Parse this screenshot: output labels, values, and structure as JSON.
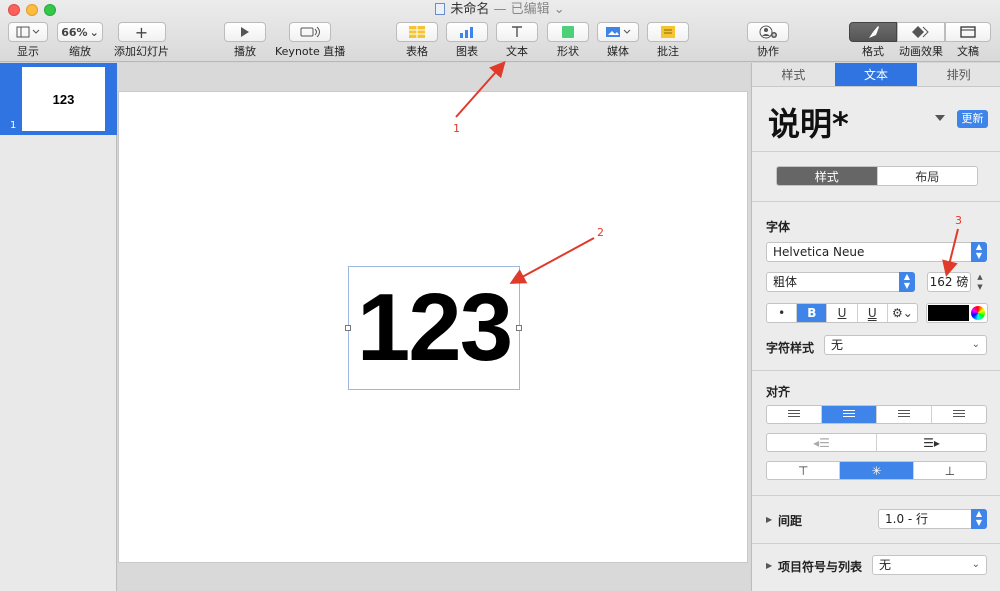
{
  "window": {
    "title": "未命名",
    "status": "— 已编辑 ⌄"
  },
  "toolbar": {
    "view": {
      "label": "显示"
    },
    "zoom": {
      "value": "66%",
      "label": "缩放"
    },
    "add_slide": {
      "label": "添加幻灯片"
    },
    "play": {
      "label": "播放"
    },
    "keynote_live": {
      "label": "Keynote 直播"
    },
    "table": {
      "label": "表格"
    },
    "chart": {
      "label": "图表"
    },
    "text": {
      "label": "文本"
    },
    "shape": {
      "label": "形状"
    },
    "media": {
      "label": "媒体"
    },
    "comment": {
      "label": "批注"
    },
    "collaborate": {
      "label": "协作"
    },
    "format": {
      "label": "格式"
    },
    "animate": {
      "label": "动画效果"
    },
    "document": {
      "label": "文稿"
    }
  },
  "navigator": {
    "slides": [
      {
        "number": "1",
        "text": "123"
      }
    ]
  },
  "slide": {
    "text": "123"
  },
  "annotations": [
    "1",
    "2",
    "3"
  ],
  "inspector": {
    "tabs": [
      "样式",
      "文本",
      "排列"
    ],
    "paragraph_style": "说明*",
    "update_label": "更新",
    "subtabs": [
      "样式",
      "布局"
    ],
    "font_section": "字体",
    "font_family": "Helvetica Neue",
    "font_weight": "粗体",
    "font_size": "162 磅",
    "format_buttons": [
      "•",
      "B",
      "U",
      "U"
    ],
    "char_style_label": "字符样式",
    "char_style_value": "无",
    "align_section": "对齐",
    "spacing_label": "间距",
    "spacing_value": "1.0 - 行",
    "bullets_label": "项目符号与列表",
    "bullets_value": "无"
  },
  "colors": {
    "accent": "#2f74e0",
    "annotation": "#e03a2a",
    "text_color": "#000000"
  }
}
